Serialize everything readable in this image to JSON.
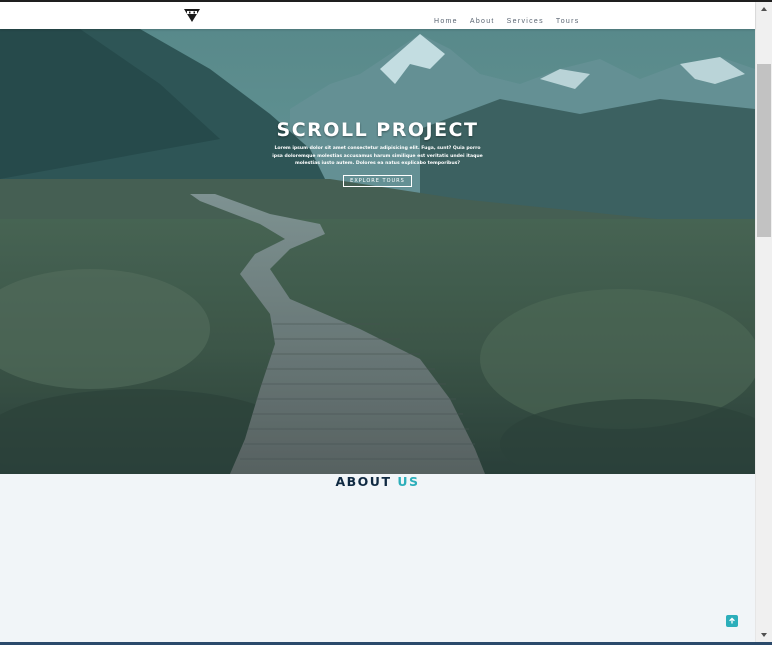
{
  "nav": {
    "logo": "logo-icon",
    "links": [
      "Home",
      "About",
      "Services",
      "Tours"
    ]
  },
  "hero": {
    "title": "SCROLL PROJECT",
    "text": "Lorem ipsum dolor sit amet consectetur adipisicing elit. Fuga, sunt? Quia porro ipsa doloremque molestias accusamus harum similique est veritatis undei itaque molestias iusto autem. Dolores ea natus explicabo temporibus?",
    "button_label": "EXPLORE TOURS"
  },
  "about": {
    "title_main": "ABOUT",
    "title_accent": "US"
  },
  "colors": {
    "accent": "#2caeba",
    "dark": "#102a42",
    "nav_text": "#5a6572",
    "background": "#f1f5f8"
  },
  "icons": {
    "scroll_top": "arrow-up-icon",
    "scroll_up": "triangle-up-icon",
    "scroll_down": "triangle-down-icon"
  }
}
